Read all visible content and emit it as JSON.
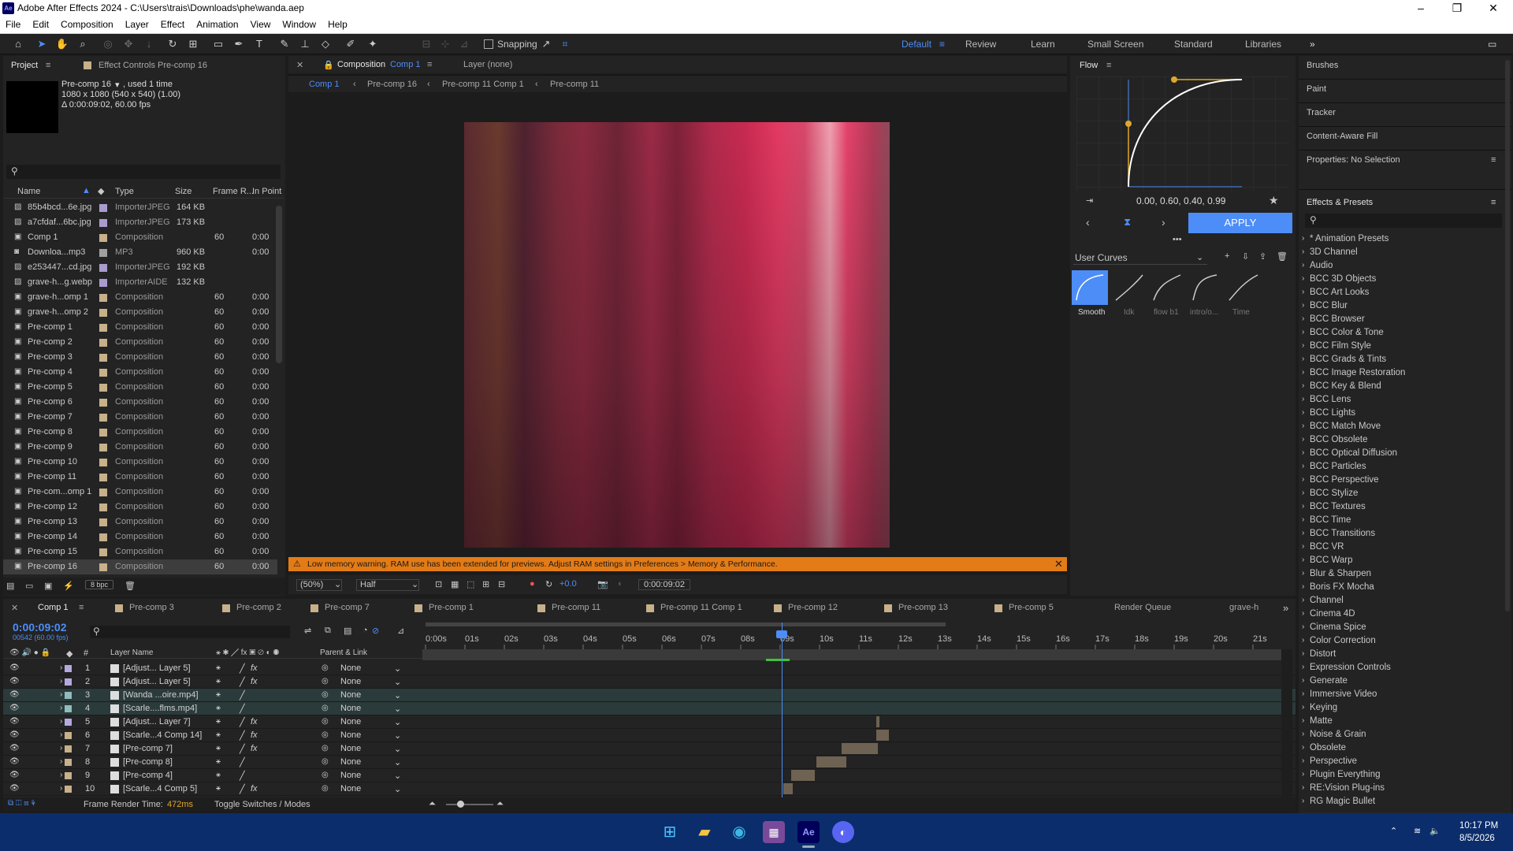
{
  "window": {
    "title": "Adobe After Effects 2024 - C:\\Users\\trais\\Downloads\\phe\\wanda.aep",
    "logo": "Ae"
  },
  "menu": [
    "File",
    "Edit",
    "Composition",
    "Layer",
    "Effect",
    "Animation",
    "View",
    "Window",
    "Help"
  ],
  "toolbar": {
    "snapping_label": "Snapping",
    "workspaces": [
      "Default",
      "Review",
      "Learn",
      "Small Screen",
      "Standard",
      "Libraries"
    ]
  },
  "project": {
    "tab_project": "Project",
    "tab_effect_controls": "Effect Controls Pre-comp 16",
    "selected_name": "Pre-comp 16",
    "selected_used": ", used 1 time",
    "selected_dims": "1080 x 1080  (540 x 540) (1.00)",
    "selected_duration": "Δ 0:00:09:02, 60.00 fps",
    "search_placeholder": "",
    "columns": [
      "Name",
      "Type",
      "Size",
      "Frame R...",
      "In Point"
    ],
    "items": [
      {
        "name": "85b4bcd...6e.jpg",
        "type": "ImporterJPEG",
        "size": "164 KB",
        "fps": "",
        "inpoint": "",
        "color": "#a89ccf",
        "icon": "image"
      },
      {
        "name": "a7cfdaf...6bc.jpg",
        "type": "ImporterJPEG",
        "size": "173 KB",
        "fps": "",
        "inpoint": "",
        "color": "#a89ccf",
        "icon": "image"
      },
      {
        "name": "Comp 1",
        "type": "Composition",
        "size": "",
        "fps": "60",
        "inpoint": "0:00",
        "color": "#c7b08a",
        "icon": "comp"
      },
      {
        "name": "Downloa...mp3",
        "type": "MP3",
        "size": "960 KB",
        "fps": "",
        "inpoint": "0:00",
        "color": "#a0a0a0",
        "icon": "audio"
      },
      {
        "name": "e253447...cd.jpg",
        "type": "ImporterJPEG",
        "size": "192 KB",
        "fps": "",
        "inpoint": "",
        "color": "#a89ccf",
        "icon": "image"
      },
      {
        "name": "grave-h...g.webp",
        "type": "ImporterAIDE",
        "size": "132 KB",
        "fps": "",
        "inpoint": "",
        "color": "#a89ccf",
        "icon": "image"
      },
      {
        "name": "grave-h...omp 1",
        "type": "Composition",
        "size": "",
        "fps": "60",
        "inpoint": "0:00",
        "color": "#c7b08a",
        "icon": "comp"
      },
      {
        "name": "grave-h...omp 2",
        "type": "Composition",
        "size": "",
        "fps": "60",
        "inpoint": "0:00",
        "color": "#c7b08a",
        "icon": "comp"
      },
      {
        "name": "Pre-comp 1",
        "type": "Composition",
        "size": "",
        "fps": "60",
        "inpoint": "0:00",
        "color": "#c7b08a",
        "icon": "comp"
      },
      {
        "name": "Pre-comp 2",
        "type": "Composition",
        "size": "",
        "fps": "60",
        "inpoint": "0:00",
        "color": "#c7b08a",
        "icon": "comp"
      },
      {
        "name": "Pre-comp 3",
        "type": "Composition",
        "size": "",
        "fps": "60",
        "inpoint": "0:00",
        "color": "#c7b08a",
        "icon": "comp"
      },
      {
        "name": "Pre-comp 4",
        "type": "Composition",
        "size": "",
        "fps": "60",
        "inpoint": "0:00",
        "color": "#c7b08a",
        "icon": "comp"
      },
      {
        "name": "Pre-comp 5",
        "type": "Composition",
        "size": "",
        "fps": "60",
        "inpoint": "0:00",
        "color": "#c7b08a",
        "icon": "comp"
      },
      {
        "name": "Pre-comp 6",
        "type": "Composition",
        "size": "",
        "fps": "60",
        "inpoint": "0:00",
        "color": "#c7b08a",
        "icon": "comp"
      },
      {
        "name": "Pre-comp 7",
        "type": "Composition",
        "size": "",
        "fps": "60",
        "inpoint": "0:00",
        "color": "#c7b08a",
        "icon": "comp"
      },
      {
        "name": "Pre-comp 8",
        "type": "Composition",
        "size": "",
        "fps": "60",
        "inpoint": "0:00",
        "color": "#c7b08a",
        "icon": "comp"
      },
      {
        "name": "Pre-comp 9",
        "type": "Composition",
        "size": "",
        "fps": "60",
        "inpoint": "0:00",
        "color": "#c7b08a",
        "icon": "comp"
      },
      {
        "name": "Pre-comp 10",
        "type": "Composition",
        "size": "",
        "fps": "60",
        "inpoint": "0:00",
        "color": "#c7b08a",
        "icon": "comp"
      },
      {
        "name": "Pre-comp 11",
        "type": "Composition",
        "size": "",
        "fps": "60",
        "inpoint": "0:00",
        "color": "#c7b08a",
        "icon": "comp"
      },
      {
        "name": "Pre-com...omp 1",
        "type": "Composition",
        "size": "",
        "fps": "60",
        "inpoint": "0:00",
        "color": "#c7b08a",
        "icon": "comp"
      },
      {
        "name": "Pre-comp 12",
        "type": "Composition",
        "size": "",
        "fps": "60",
        "inpoint": "0:00",
        "color": "#c7b08a",
        "icon": "comp"
      },
      {
        "name": "Pre-comp 13",
        "type": "Composition",
        "size": "",
        "fps": "60",
        "inpoint": "0:00",
        "color": "#c7b08a",
        "icon": "comp"
      },
      {
        "name": "Pre-comp 14",
        "type": "Composition",
        "size": "",
        "fps": "60",
        "inpoint": "0:00",
        "color": "#c7b08a",
        "icon": "comp"
      },
      {
        "name": "Pre-comp 15",
        "type": "Composition",
        "size": "",
        "fps": "60",
        "inpoint": "0:00",
        "color": "#c7b08a",
        "icon": "comp"
      },
      {
        "name": "Pre-comp 16",
        "type": "Composition",
        "size": "",
        "fps": "60",
        "inpoint": "0:00",
        "color": "#c7b08a",
        "icon": "comp"
      }
    ],
    "bpc": "8 bpc"
  },
  "viewer": {
    "tab_label": "Composition",
    "tab_comp": "Comp 1",
    "layer_tab": "Layer (none)",
    "breadcrumbs": [
      "Comp 1",
      "Pre-comp 16",
      "Pre-comp 11 Comp 1",
      "Pre-comp 11"
    ],
    "warning": "Low memory warning. RAM use has been extended for previews. Adjust RAM settings in Preferences > Memory & Performance.",
    "zoom": "(50%)",
    "resolution": "Half",
    "exposure": "+0.0",
    "timecode": "0:00:09:02"
  },
  "flow": {
    "title": "Flow",
    "values": "0.00, 0.60, 0.40, 0.99",
    "apply": "APPLY",
    "curves_label": "User Curves",
    "presets": [
      "Smooth",
      "Idk",
      "flow b1",
      "intro/o...",
      "Time"
    ]
  },
  "right_panels": {
    "items": [
      "Brushes",
      "Paint",
      "Tracker",
      "Content-Aware Fill",
      "Properties: No Selection"
    ]
  },
  "effects": {
    "title": "Effects & Presets",
    "search_placeholder": "",
    "items": [
      "* Animation Presets",
      "3D Channel",
      "Audio",
      "BCC 3D Objects",
      "BCC Art Looks",
      "BCC Blur",
      "BCC Browser",
      "BCC Color & Tone",
      "BCC Film Style",
      "BCC Grads & Tints",
      "BCC Image Restoration",
      "BCC Key & Blend",
      "BCC Lens",
      "BCC Lights",
      "BCC Match Move",
      "BCC Obsolete",
      "BCC Optical Diffusion",
      "BCC Particles",
      "BCC Perspective",
      "BCC Stylize",
      "BCC Textures",
      "BCC Time",
      "BCC Transitions",
      "BCC VR",
      "BCC Warp",
      "Blur & Sharpen",
      "Boris FX Mocha",
      "Channel",
      "Cinema 4D",
      "Cinema Spice",
      "Color Correction",
      "Distort",
      "Expression Controls",
      "Generate",
      "Immersive Video",
      "Keying",
      "Matte",
      "Noise & Grain",
      "Obsolete",
      "Perspective",
      "Plugin Everything",
      "RE:Vision Plug-ins",
      "RG Magic Bullet"
    ]
  },
  "timeline": {
    "tabs": [
      "Comp 1",
      "Pre-comp 3",
      "Pre-comp 2",
      "Pre-comp 7",
      "Pre-comp 1",
      "Pre-comp 11",
      "Pre-comp 11 Comp 1",
      "Pre-comp 12",
      "Pre-comp 13",
      "Pre-comp 5",
      "Render Queue",
      "grave-h"
    ],
    "timecode": "0:00:09:02",
    "frames": "00542 (60.00 fps)",
    "col_layer_name": "Layer Name",
    "col_parent": "Parent & Link",
    "ruler": [
      "0:00s",
      "01s",
      "02s",
      "03s",
      "04s",
      "05s",
      "06s",
      "07s",
      "08s",
      "09s",
      "10s",
      "11s",
      "12s",
      "13s",
      "14s",
      "15s",
      "16s",
      "17s",
      "18s",
      "19s",
      "20s",
      "21s"
    ],
    "layers": [
      {
        "num": "1",
        "name": "[Adjust... Layer 5]",
        "parent": "None",
        "fx": "fx",
        "color": "#b6a9e0"
      },
      {
        "num": "2",
        "name": "[Adjust... Layer 5]",
        "parent": "None",
        "fx": "fx",
        "color": "#b6a9e0"
      },
      {
        "num": "3",
        "name": "[Wanda ...oire.mp4]",
        "parent": "None",
        "fx": "",
        "color": "#8fbcbc"
      },
      {
        "num": "4",
        "name": "[Scarle....flms.mp4]",
        "parent": "None",
        "fx": "",
        "color": "#8fbcbc"
      },
      {
        "num": "5",
        "name": "[Adjust... Layer 7]",
        "parent": "None",
        "fx": "fx",
        "color": "#b6a9e0"
      },
      {
        "num": "6",
        "name": "[Scarle...4 Comp 14]",
        "parent": "None",
        "fx": "fx",
        "color": "#c7b08a"
      },
      {
        "num": "7",
        "name": "[Pre-comp 7]",
        "parent": "None",
        "fx": "fx",
        "color": "#c7b08a"
      },
      {
        "num": "8",
        "name": "[Pre-comp 8]",
        "parent": "None",
        "fx": "",
        "color": "#c7b08a"
      },
      {
        "num": "9",
        "name": "[Pre-comp 4]",
        "parent": "None",
        "fx": "",
        "color": "#c7b08a"
      },
      {
        "num": "10",
        "name": "[Scarle...4 Comp 5]",
        "parent": "None",
        "fx": "fx",
        "color": "#c7b08a"
      }
    ],
    "frame_render_label": "Frame Render Time:",
    "frame_render_value": "472ms",
    "toggle_label": "Toggle Switches / Modes"
  },
  "taskbar": {
    "time": "10:17 PM",
    "date": "8/5/2026"
  }
}
